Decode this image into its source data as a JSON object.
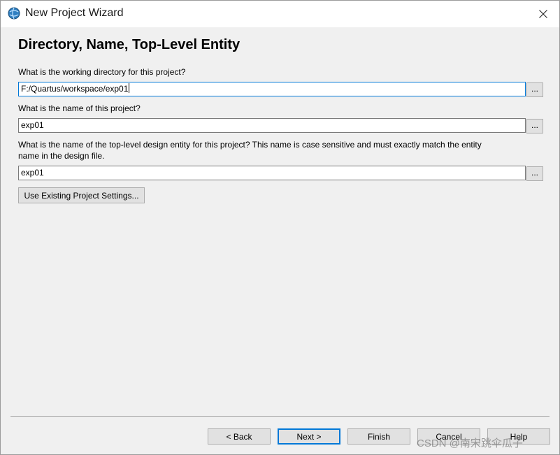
{
  "window": {
    "title": "New Project Wizard",
    "icon": "quartus-globe-icon"
  },
  "page": {
    "heading": "Directory, Name, Top-Level Entity",
    "working_dir_label": "What is the working directory for this project?",
    "working_dir_value": "F:/Quartus/workspace/exp01",
    "project_name_label": "What is the name of this project?",
    "project_name_value": "exp01",
    "top_entity_label_line1": "What is the name of the top-level design entity for this project? This name is case sensitive and must exactly match the entity",
    "top_entity_label_line2": "name in the design file.",
    "top_entity_value": "exp01",
    "browse_label": "...",
    "use_existing_label": "Use Existing Project Settings..."
  },
  "footer": {
    "back_label": "< Back",
    "next_label": "Next >",
    "finish_label": "Finish",
    "cancel_label": "Cancel",
    "help_label": "Help",
    "watermark": "CSDN @南宋跳伞瓜子"
  },
  "colors": {
    "focus_accent": "#0078d7",
    "dialog_bg": "#f0f0f0"
  }
}
